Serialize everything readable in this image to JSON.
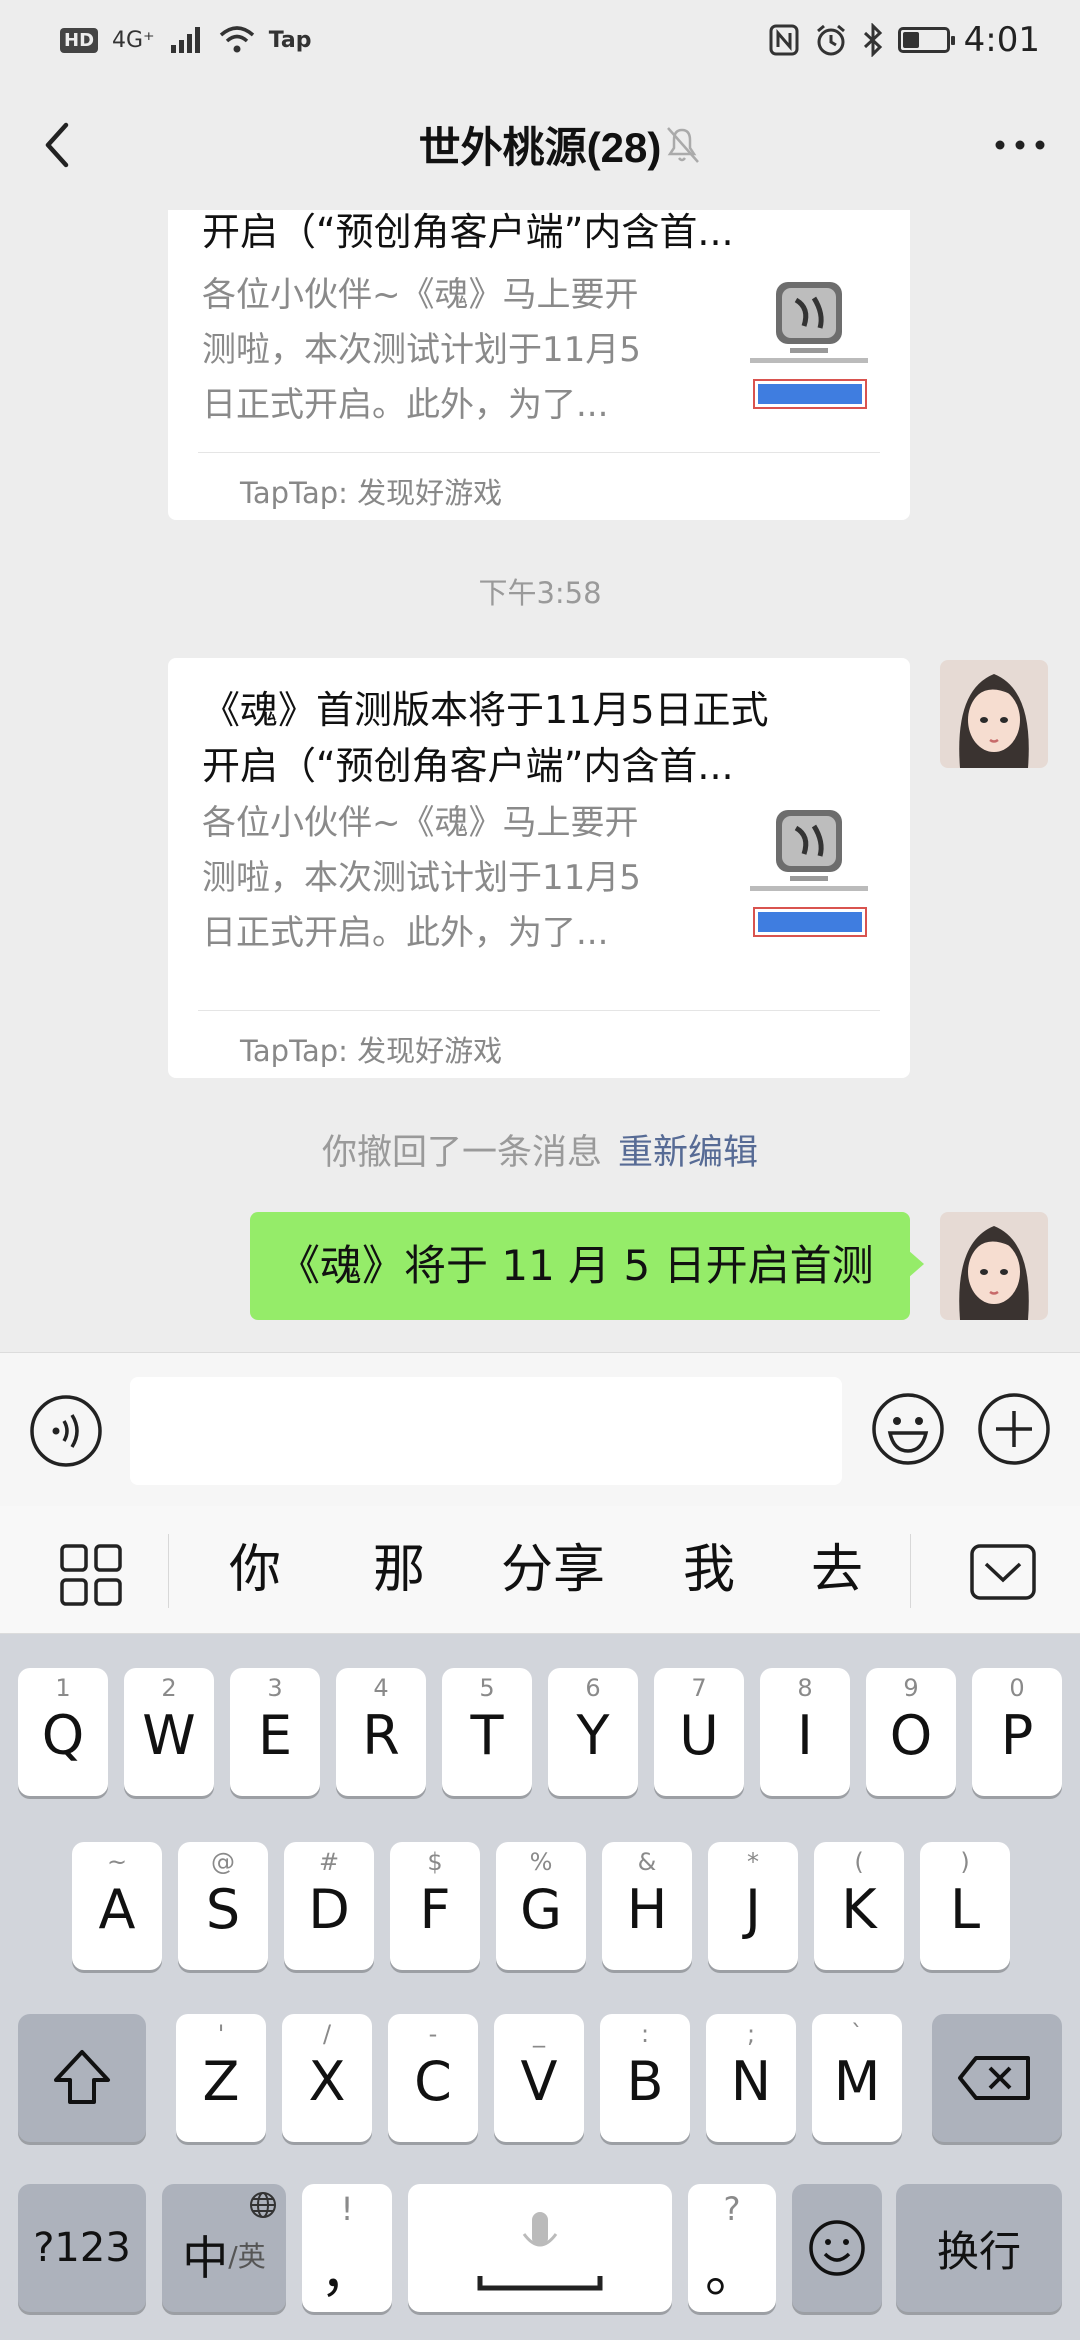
{
  "status_bar": {
    "network": "4G⁺",
    "carrier_app": "Tap",
    "time": "4:01",
    "battery_level": 0.35
  },
  "nav": {
    "title": "世外桃源(28)",
    "icons": [
      "chevron-left-icon",
      "bell-muted-icon",
      "more-dots-icon"
    ]
  },
  "messages": {
    "card1": {
      "title_line2": "开启（“预创角客户端”内含首...",
      "desc": [
        "各位小伙伴~《魂》马上要开",
        "测啦，本次测试计划于11月5",
        "日正式开启。此外，为了..."
      ],
      "source": "TapTap: 发现好游戏"
    },
    "timestamp": "下午3:58",
    "card2": {
      "title": [
        "《魂》首测版本将于11月5日正式",
        "开启（“预创角客户端”内含首..."
      ],
      "desc": [
        "各位小伙伴~《魂》马上要开",
        "测啦，本次测试计划于11月5",
        "日正式开启。此外，为了..."
      ],
      "source": "TapTap: 发现好游戏"
    },
    "recall": {
      "text": "你撤回了一条消息",
      "link": "重新编辑"
    },
    "my_message": "《魂》将于 11 月 5 日开启首测"
  },
  "input_bar": {
    "value": "",
    "icons": [
      "voice-icon",
      "emoji-icon",
      "plus-icon"
    ]
  },
  "candidates": [
    "你",
    "那",
    "分享",
    "我",
    "去"
  ],
  "keyboard": {
    "row1": [
      [
        "1",
        "Q"
      ],
      [
        "2",
        "W"
      ],
      [
        "3",
        "E"
      ],
      [
        "4",
        "R"
      ],
      [
        "5",
        "T"
      ],
      [
        "6",
        "Y"
      ],
      [
        "7",
        "U"
      ],
      [
        "8",
        "I"
      ],
      [
        "9",
        "O"
      ],
      [
        "0",
        "P"
      ]
    ],
    "row2": [
      [
        "~",
        "A"
      ],
      [
        "@",
        "S"
      ],
      [
        "#",
        "D"
      ],
      [
        "$",
        "F"
      ],
      [
        "%",
        "G"
      ],
      [
        "&",
        "H"
      ],
      [
        "*",
        "J"
      ],
      [
        "(",
        "K"
      ],
      [
        ")",
        "L"
      ]
    ],
    "row3": [
      [
        "'",
        "Z"
      ],
      [
        "/",
        "X"
      ],
      [
        "-",
        "C"
      ],
      [
        "_",
        "V"
      ],
      [
        ":",
        "B"
      ],
      [
        ";",
        "N"
      ],
      [
        "`",
        "M"
      ]
    ],
    "num_key": "?123",
    "lang_key_main": "中",
    "lang_key_sub": "/英",
    "comma_hint": "!",
    "comma": "，",
    "period_hint": "?",
    "period": "。",
    "enter_key": "换行"
  },
  "colors": {
    "background": "#ededed",
    "my_bubble": "#95ec69",
    "link": "#576b95"
  }
}
